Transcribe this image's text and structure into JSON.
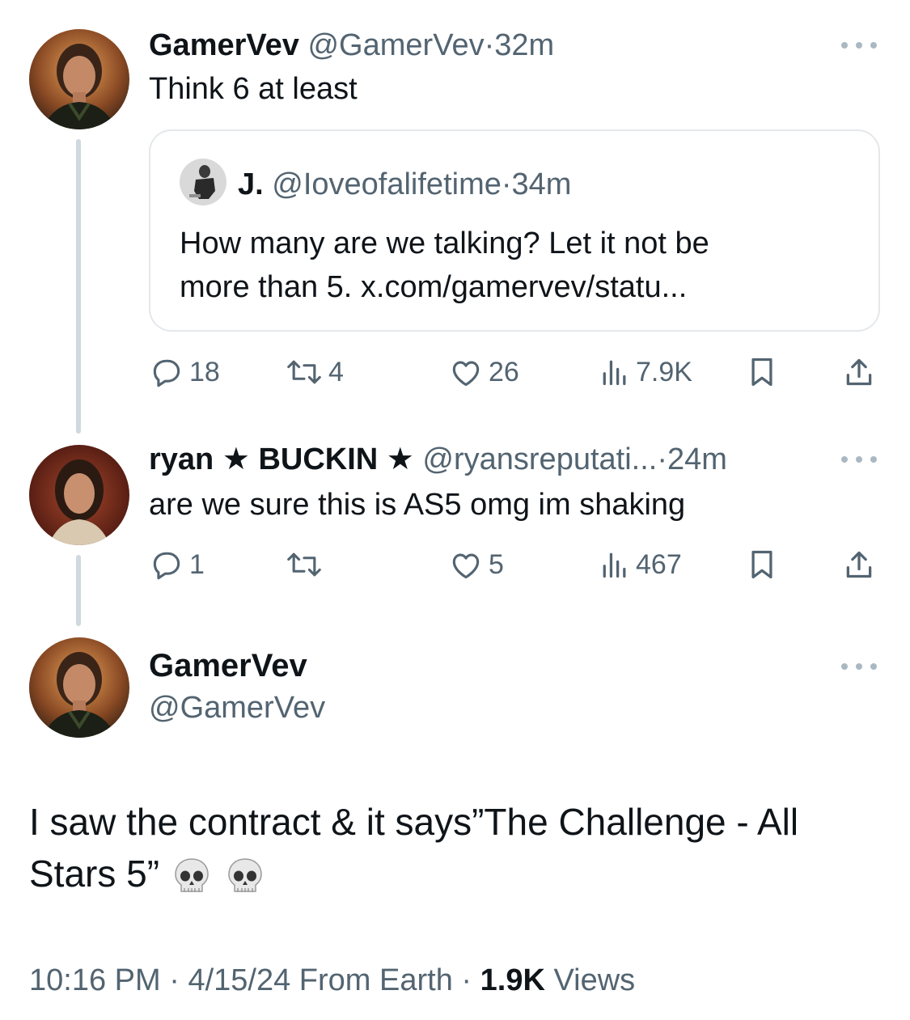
{
  "tweet1": {
    "name": "GamerVev",
    "handle": "@GamerVev",
    "time": "32m",
    "text": "Think 6 at least",
    "quote": {
      "name": "J.",
      "handle": "@Ioveofalifetime",
      "time": "34m",
      "text_line1": "How many are we talking? Let it not be",
      "text_line2": "more than 5. x.com/gamervev/statu..."
    },
    "actions": {
      "replies": "18",
      "retweets": "4",
      "likes": "26",
      "views": "7.9K"
    }
  },
  "tweet2": {
    "name": "ryan ★ BUCKIN ★",
    "handle": "@ryansreputati...",
    "time": "24m",
    "text": "are we sure this is AS5 omg im shaking",
    "actions": {
      "replies": "1",
      "retweets": "",
      "likes": "5",
      "views": "467"
    }
  },
  "main_tweet": {
    "name": "GamerVev",
    "handle": "@GamerVev",
    "text": "I saw the contract & it says”The Challenge - All Stars 5”",
    "emojis": [
      "skull-emoji",
      "skull-emoji"
    ],
    "footer": {
      "time": "10:16 PM",
      "date": "4/15/24",
      "source": "From Earth",
      "views_count": "1.9K",
      "views_label": "Views"
    }
  },
  "separator": "·",
  "colors": {
    "text": "#0f1419",
    "secondary": "#536471",
    "line": "#cfd9de",
    "border": "#e4e8eb"
  },
  "icons": [
    "reply-icon",
    "retweet-icon",
    "like-icon",
    "views-icon",
    "bookmark-icon",
    "share-icon",
    "more-icon"
  ]
}
